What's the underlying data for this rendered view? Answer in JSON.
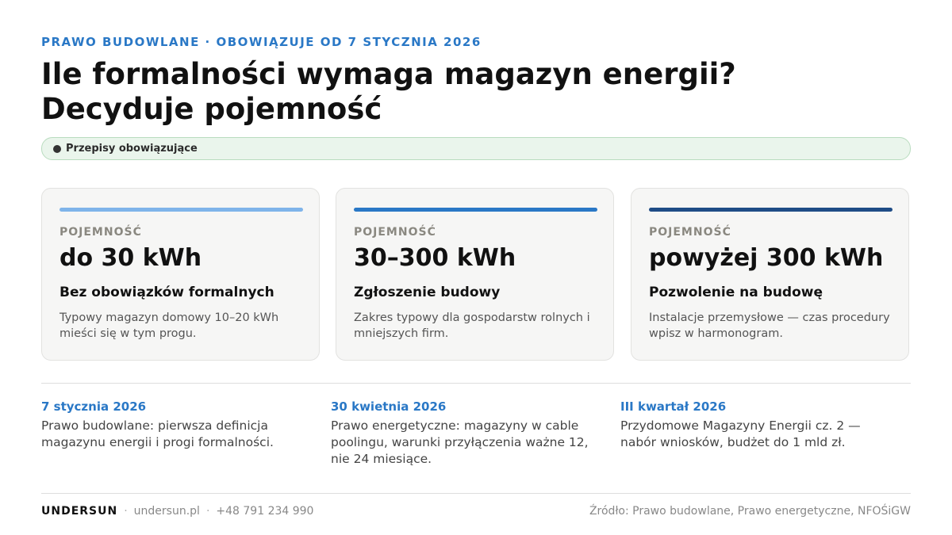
{
  "header": {
    "kicker": "PRAWO BUDOWLANE · OBOWIĄZUJE OD 7 STYCZNIA 2026",
    "title_line1": "Ile formalności wymaga magazyn energii?",
    "title_line2": "Decyduje pojemność"
  },
  "status": {
    "label": "Przepisy obowiązujące"
  },
  "cards": [
    {
      "label": "POJEMNOŚĆ",
      "value": "do 30 kWh",
      "heading": "Bez obowiązków formalnych",
      "description": "Typowy magazyn domowy 10–20 kWh mieści się w tym progu.",
      "accent": "#7fb4ea"
    },
    {
      "label": "POJEMNOŚĆ",
      "value": "30–300 kWh",
      "heading": "Zgłoszenie budowy",
      "description": "Zakres typowy dla gospodarstw rolnych i mniejszych firm.",
      "accent": "#2a78c6"
    },
    {
      "label": "POJEMNOŚĆ",
      "value": "powyżej 300 kWh",
      "heading": "Pozwolenie na budowę",
      "description": "Instalacje przemysłowe — czas procedury wpisz w harmonogram.",
      "accent": "#1f4c86"
    }
  ],
  "timeline": [
    {
      "date": "7 stycznia 2026",
      "text": "Prawo budowlane: pierwsza definicja magazynu energii i progi formalności."
    },
    {
      "date": "30 kwietnia 2026",
      "text": "Prawo energetyczne: magazyny w cable poolingu, warunki przyłączenia ważne 12, nie 24 miesiące."
    },
    {
      "date": "III kwartał 2026",
      "text": "Przydomowe Magazyny Energii cz. 2 — nabór wniosków, budżet do 1 mld zł."
    }
  ],
  "footer": {
    "brand": "UNDERSUN",
    "separator": "·",
    "website": "undersun.pl",
    "phone": "+48 791 234 990",
    "source": "Źródło: Prawo budowlane, Prawo energetyczne, NFOŚiGW"
  },
  "colors": {
    "accent_blue": "#2a78c6",
    "status_bg": "#eaf5ec",
    "status_border": "#b9dcbf"
  }
}
